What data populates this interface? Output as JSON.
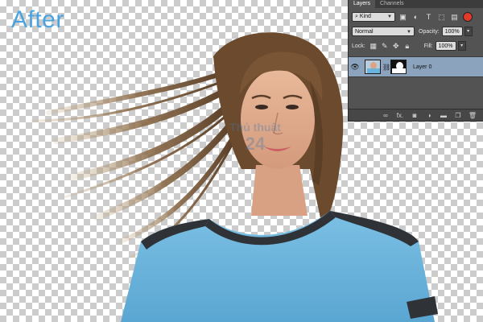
{
  "canvas": {
    "label": "After"
  },
  "watermark": {
    "text_top": "Thủ thuật",
    "text_bottom": "24"
  },
  "layers_panel": {
    "tabs": [
      {
        "label": "Layers"
      },
      {
        "label": "Channels"
      }
    ],
    "filter": {
      "label": "Kind",
      "icon": "search-icon"
    },
    "blend_mode": {
      "value": "Normal"
    },
    "opacity": {
      "label": "Opacity:",
      "value": "100%"
    },
    "lock": {
      "label": "Lock:"
    },
    "fill": {
      "label": "Fill:",
      "value": "100%"
    },
    "layers": [
      {
        "name": "Layer 0",
        "visible": true,
        "selected": true
      }
    ],
    "footer_icons": [
      "link-layers-icon",
      "fx-icon",
      "add-mask-icon",
      "adjustment-icon",
      "group-folder-icon",
      "new-layer-icon",
      "trash-icon"
    ],
    "footer_fx_label": "fx."
  },
  "colors": {
    "label_blue": "#4aa3df",
    "panel_bg": "#535353",
    "selected_layer": "#8ba3bd",
    "shirt": "#6ab3dc"
  }
}
